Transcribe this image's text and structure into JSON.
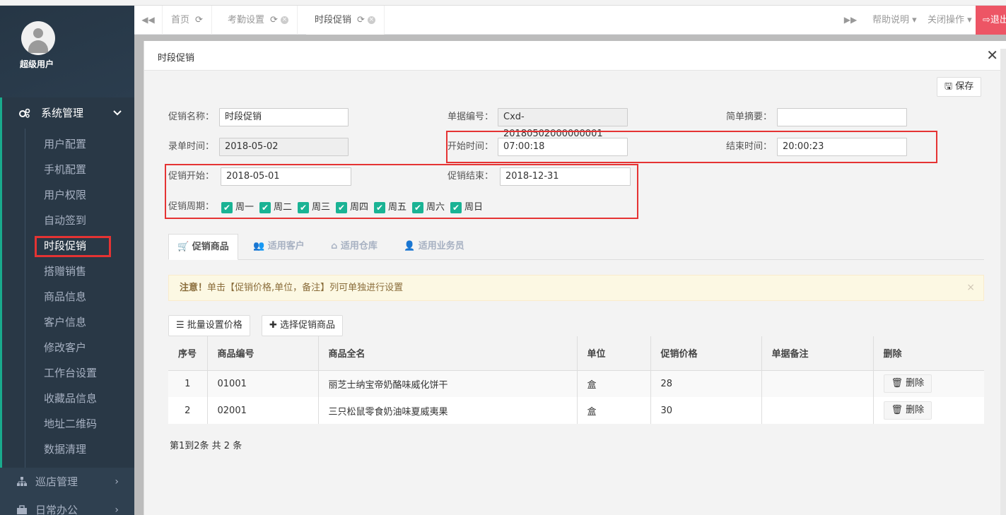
{
  "user": {
    "name": "超级用户"
  },
  "sidebar": {
    "group": {
      "label": "系统管理",
      "chevron": "⌄"
    },
    "items": [
      {
        "label": "用户配置",
        "active": false
      },
      {
        "label": "手机配置",
        "active": false
      },
      {
        "label": "用户权限",
        "active": false
      },
      {
        "label": "自动签到",
        "active": false
      },
      {
        "label": "时段促销",
        "active": true
      },
      {
        "label": "搭赠销售",
        "active": false
      },
      {
        "label": "商品信息",
        "active": false
      },
      {
        "label": "客户信息",
        "active": false
      },
      {
        "label": "修改客户",
        "active": false
      },
      {
        "label": "工作台设置",
        "active": false
      },
      {
        "label": "收藏品信息",
        "active": false
      },
      {
        "label": "地址二维码",
        "active": false
      },
      {
        "label": "数据清理",
        "active": false
      }
    ],
    "group2": {
      "label": "巡店管理",
      "chevron": "›"
    },
    "group3": {
      "label": "日常办公",
      "chevron": "›"
    }
  },
  "tabs": {
    "items": [
      {
        "label": "首页"
      },
      {
        "label": "考勤设置"
      },
      {
        "label": "时段促销"
      }
    ],
    "help": "帮助说明",
    "close_ops": "关闭操作",
    "logout": "退出"
  },
  "dialog": {
    "title": "时段促销",
    "save": "保存",
    "form": {
      "name_label": "促销名称：",
      "name_value": "时段促销",
      "code_label": "单据编号：",
      "code_value": "Cxd-20180502000000001",
      "summary_label": "简单摘要：",
      "summary_value": "",
      "entry_label": "录单时间：",
      "entry_value": "2018-05-02",
      "start_time_label": "开始时间：",
      "start_time_value": "07:00:18",
      "end_time_label": "结束时间：",
      "end_time_value": "20:00:23",
      "promo_start_label": "促销开始：",
      "promo_start_value": "2018-05-01",
      "promo_end_label": "促销结束：",
      "promo_end_value": "2018-12-31",
      "cycle_label": "促销周期：",
      "days": [
        "周一",
        "周二",
        "周三",
        "周四",
        "周五",
        "周六",
        "周日"
      ]
    },
    "inner_tabs": [
      "促销商品",
      "适用客户",
      "适用仓库",
      "适用业务员"
    ],
    "alert": {
      "strong": "注意！",
      "text": "单击【促销价格,单位，备注】列可单独进行设置"
    },
    "batch_btn": "批量设置价格",
    "select_btn": "选择促销商品",
    "table": {
      "headers": [
        "序号",
        "商品编号",
        "商品全名",
        "单位",
        "促销价格",
        "单据备注",
        "删除"
      ],
      "rows": [
        {
          "no": "1",
          "code": "01001",
          "name": "丽芝士纳宝帝奶酪味威化饼干",
          "unit": "盒",
          "price": "28",
          "note": "",
          "del": "删除"
        },
        {
          "no": "2",
          "code": "02001",
          "name": "三只松鼠零食奶油味夏威夷果",
          "unit": "盒",
          "price": "30",
          "note": "",
          "del": "删除"
        }
      ]
    },
    "pager": "第1到2条 共 2 条"
  }
}
